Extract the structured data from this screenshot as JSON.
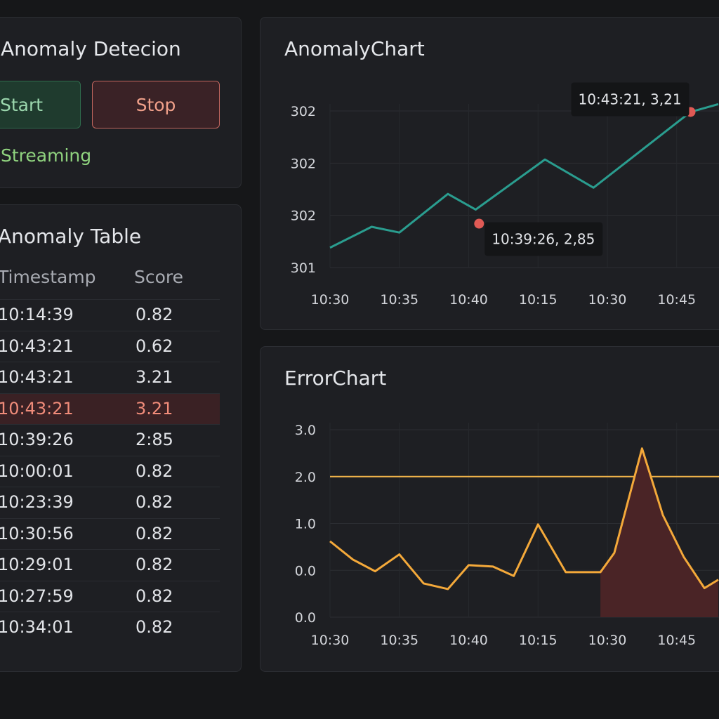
{
  "control": {
    "title": "Anomaly Detecion",
    "start_label": "Start",
    "stop_label": "Stop",
    "status": "Streaming"
  },
  "table": {
    "title": "Anomaly Table",
    "headers": [
      "Timestamp",
      "Score"
    ],
    "rows": [
      {
        "ts": "10:14:39",
        "score": "0.82",
        "flag": false
      },
      {
        "ts": "10:43:21",
        "score": "0.62",
        "flag": false
      },
      {
        "ts": "10:43:21",
        "score": "3.21",
        "flag": false
      },
      {
        "ts": "10:43:21",
        "score": "3.21",
        "flag": true
      },
      {
        "ts": "10:39:26",
        "score": "2:85",
        "flag": false
      },
      {
        "ts": "10:00:01",
        "score": "0.82",
        "flag": false
      },
      {
        "ts": "10:23:39",
        "score": "0.82",
        "flag": false
      },
      {
        "ts": "10:30:56",
        "score": "0.82",
        "flag": false
      },
      {
        "ts": "10:29:01",
        "score": "0.82",
        "flag": false
      },
      {
        "ts": "10:27:59",
        "score": "0.82",
        "flag": false
      },
      {
        "ts": "10:34:01",
        "score": "0.82",
        "flag": false
      }
    ]
  },
  "colors": {
    "anomaly_line": "#2a9d8f",
    "anomaly_marker": "#e05a55",
    "error_line": "#f4a93a",
    "error_threshold": "#f2b54a",
    "error_fill": "#4a2426",
    "flag_row": "#3a2124"
  },
  "chart_data": [
    {
      "id": "anomaly",
      "type": "line",
      "title": "AnomalyChart",
      "x_ticks": [
        "10:30",
        "10:35",
        "10:40",
        "10:15",
        "10:30",
        "10:45"
      ],
      "y_ticks": [
        "301",
        "302",
        "302",
        "302"
      ],
      "y_range": [
        0,
        3
      ],
      "x_range": [
        0,
        5.6
      ],
      "series": [
        {
          "x": [
            0,
            0.6,
            1.0,
            1.7,
            2.1,
            3.1,
            3.8,
            5.2,
            5.6
          ],
          "y": [
            0.38,
            0.78,
            0.67,
            1.41,
            1.11,
            2.07,
            1.53,
            2.98,
            3.13
          ]
        }
      ],
      "markers": [
        {
          "x": 2.15,
          "y": 0.84,
          "label": "10:39:26, 2,85"
        },
        {
          "x": 5.2,
          "y": 2.98,
          "label": "10:43:21, 3,21"
        }
      ]
    },
    {
      "id": "error",
      "type": "line",
      "title": "ErrorChart",
      "x_ticks": [
        "10:30",
        "10:35",
        "10:40",
        "10:15",
        "10:30",
        "10:45"
      ],
      "y_ticks": [
        "0.0",
        "0.0",
        "1.0",
        "2.0",
        "3.0"
      ],
      "y_range": [
        0,
        4
      ],
      "x_range": [
        0,
        5.6
      ],
      "threshold": 3.0,
      "series": [
        {
          "x": [
            0,
            0.33,
            0.65,
            1.0,
            1.35,
            1.7,
            2.0,
            2.35,
            2.65,
            3.0,
            3.4,
            3.9,
            4.1,
            4.5,
            4.8,
            5.1,
            5.4,
            5.6
          ],
          "y": [
            1.62,
            1.23,
            0.98,
            1.34,
            0.72,
            0.6,
            1.11,
            1.08,
            0.88,
            1.98,
            0.96,
            0.96,
            1.37,
            3.6,
            2.18,
            1.29,
            0.62,
            0.8
          ]
        }
      ],
      "shaded_from_x": 3.9
    }
  ]
}
